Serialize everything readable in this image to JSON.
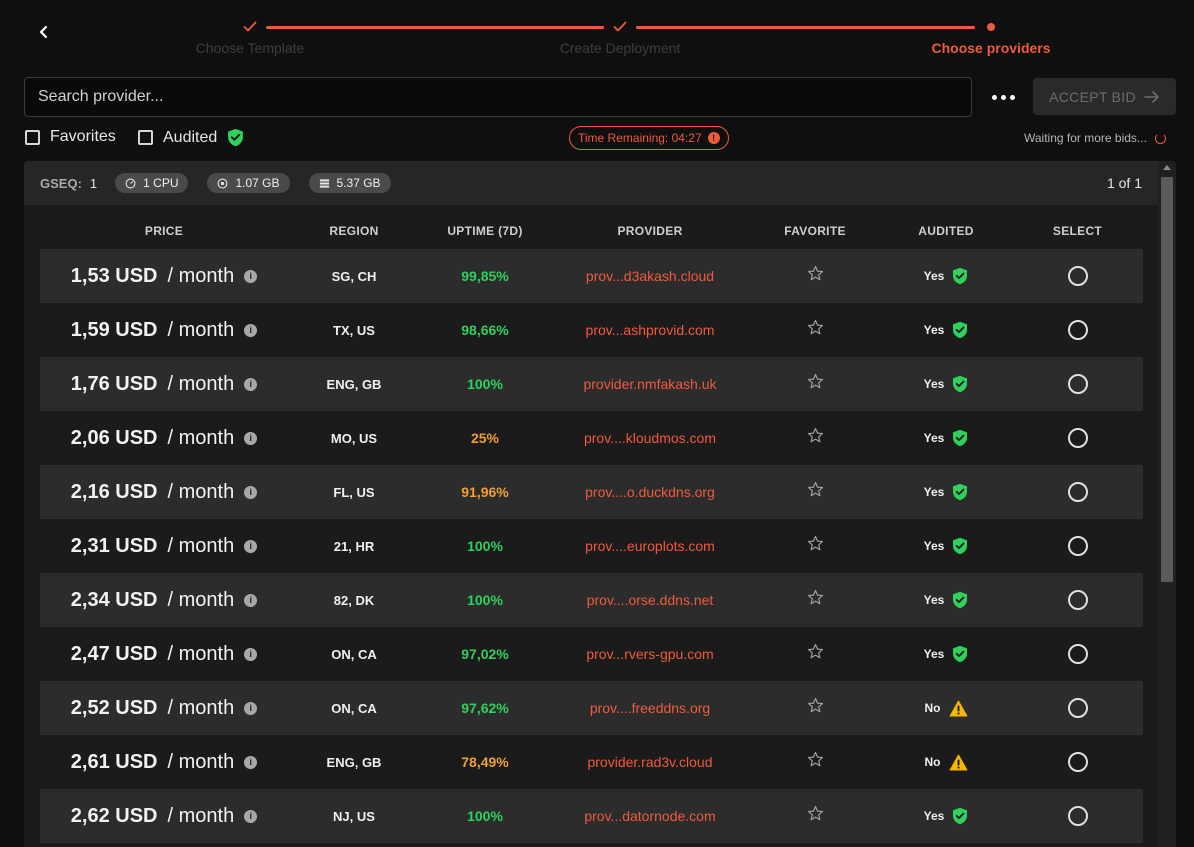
{
  "stepper": {
    "steps": [
      {
        "label": "Choose Template",
        "state": "done"
      },
      {
        "label": "Create Deployment",
        "state": "done"
      },
      {
        "label": "Choose providers",
        "state": "active"
      }
    ]
  },
  "search": {
    "placeholder": "Search provider..."
  },
  "accept_button": {
    "label": "ACCEPT BID"
  },
  "filters": {
    "favorites_label": "Favorites",
    "audited_label": "Audited"
  },
  "timer": {
    "text": "Time Remaining: 04:27"
  },
  "waiting": {
    "text": "Waiting for more bids..."
  },
  "group": {
    "gseq_label": "GSEQ:",
    "gseq_value": "1",
    "cpu": "1 CPU",
    "memory": "1.07 GB",
    "storage": "5.37 GB",
    "page_count": "1 of 1"
  },
  "table": {
    "headers": {
      "price": "PRICE",
      "region": "REGION",
      "uptime": "UPTIME (7D)",
      "provider": "PROVIDER",
      "favorite": "FAVORITE",
      "audited": "AUDITED",
      "select": "SELECT"
    },
    "per_label": "/ month",
    "rows": [
      {
        "price": "1,53 USD",
        "region": "SG, CH",
        "uptime": "99,85%",
        "uptime_color": "#2fd15c",
        "provider": "prov...d3akash.cloud",
        "audited": "Yes",
        "audit_icon": "shield-check-icon"
      },
      {
        "price": "1,59 USD",
        "region": "TX, US",
        "uptime": "98,66%",
        "uptime_color": "#2fd15c",
        "provider": "prov...ashprovid.com",
        "audited": "Yes",
        "audit_icon": "shield-check-icon"
      },
      {
        "price": "1,76 USD",
        "region": "ENG, GB",
        "uptime": "100%",
        "uptime_color": "#2fd15c",
        "provider": "provider.nmfakash.uk",
        "audited": "Yes",
        "audit_icon": "shield-check-icon"
      },
      {
        "price": "2,06 USD",
        "region": "MO, US",
        "uptime": "25%",
        "uptime_color": "#f0a030",
        "provider": "prov....kloudmos.com",
        "audited": "Yes",
        "audit_icon": "shield-check-icon"
      },
      {
        "price": "2,16 USD",
        "region": "FL, US",
        "uptime": "91,96%",
        "uptime_color": "#f0a030",
        "provider": "prov....o.duckdns.org",
        "audited": "Yes",
        "audit_icon": "shield-check-icon"
      },
      {
        "price": "2,31 USD",
        "region": "21, HR",
        "uptime": "100%",
        "uptime_color": "#2fd15c",
        "provider": "prov....europlots.com",
        "audited": "Yes",
        "audit_icon": "shield-check-icon"
      },
      {
        "price": "2,34 USD",
        "region": "82, DK",
        "uptime": "100%",
        "uptime_color": "#2fd15c",
        "provider": "prov....orse.ddns.net",
        "audited": "Yes",
        "audit_icon": "shield-check-icon"
      },
      {
        "price": "2,47 USD",
        "region": "ON, CA",
        "uptime": "97,02%",
        "uptime_color": "#2fd15c",
        "provider": "prov...rvers-gpu.com",
        "audited": "Yes",
        "audit_icon": "shield-check-icon"
      },
      {
        "price": "2,52 USD",
        "region": "ON, CA",
        "uptime": "97,62%",
        "uptime_color": "#2fd15c",
        "provider": "prov....freeddns.org",
        "audited": "No",
        "audit_icon": "warning-icon"
      },
      {
        "price": "2,61 USD",
        "region": "ENG, GB",
        "uptime": "78,49%",
        "uptime_color": "#f0a030",
        "provider": "provider.rad3v.cloud",
        "audited": "No",
        "audit_icon": "warning-icon"
      },
      {
        "price": "2,62 USD",
        "region": "NJ, US",
        "uptime": "100%",
        "uptime_color": "#2fd15c",
        "provider": "prov...datornode.com",
        "audited": "Yes",
        "audit_icon": "shield-check-icon"
      }
    ]
  },
  "colors": {
    "accent": "#ef5a3c",
    "uptime_good": "#2fd15c",
    "uptime_warn": "#f0a030",
    "audited_green": "#2fd15c",
    "warning_yellow": "#f5b800"
  }
}
